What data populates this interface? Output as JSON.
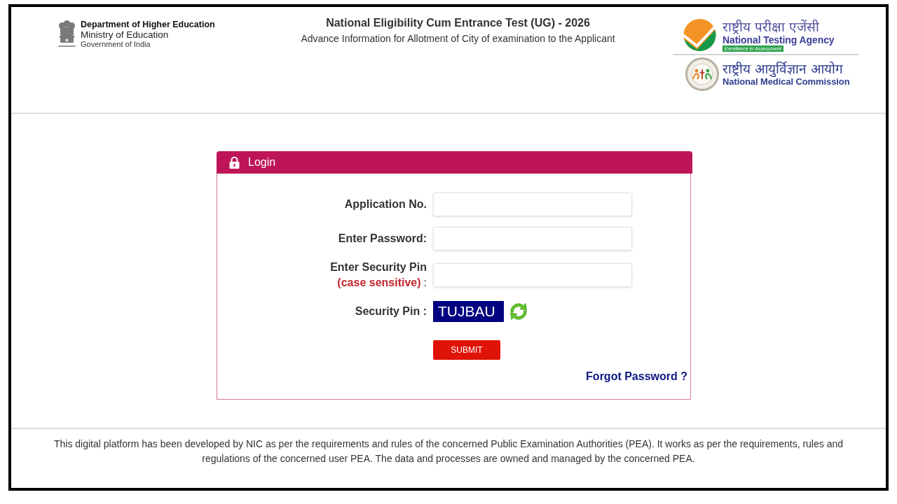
{
  "header": {
    "ministry": {
      "department": "Department of Higher Education",
      "ministry": "Ministry of Education",
      "government": "Government of India"
    },
    "title": "National Eligibility Cum Entrance Test (UG) - 2026",
    "subtitle": "Advance Information for Allotment of City of examination to the Applicant",
    "logos": [
      {
        "kind": "nta",
        "hindi": "राष्ट्रीय परीक्षा एजेंसी",
        "name": "National Testing Agency",
        "tagline": "Excellence in Assessment"
      },
      {
        "kind": "nmc",
        "hindi": "राष्ट्रीय आयुर्विज्ञान आयोग",
        "name": "National Medical Commission"
      }
    ]
  },
  "login": {
    "title": "Login",
    "fields": [
      {
        "label": "Application No."
      },
      {
        "label": "Enter Password:"
      },
      {
        "label": "Enter Security Pin",
        "note": "(case sensitive)",
        "suffix": ":"
      }
    ],
    "captcha": {
      "label": "Security Pin :",
      "code": "TUJBAU"
    },
    "submit": "SUBMIT",
    "forgot": "Forgot Password ?"
  },
  "footer": {
    "text": "This digital platform has been developed by NIC as per the requirements and rules of the concerned Public Examination Authorities (PEA). It works as per the requirements, rules and regulations of the concerned user PEA. The data and processes are owned and managed by the concerned PEA."
  }
}
